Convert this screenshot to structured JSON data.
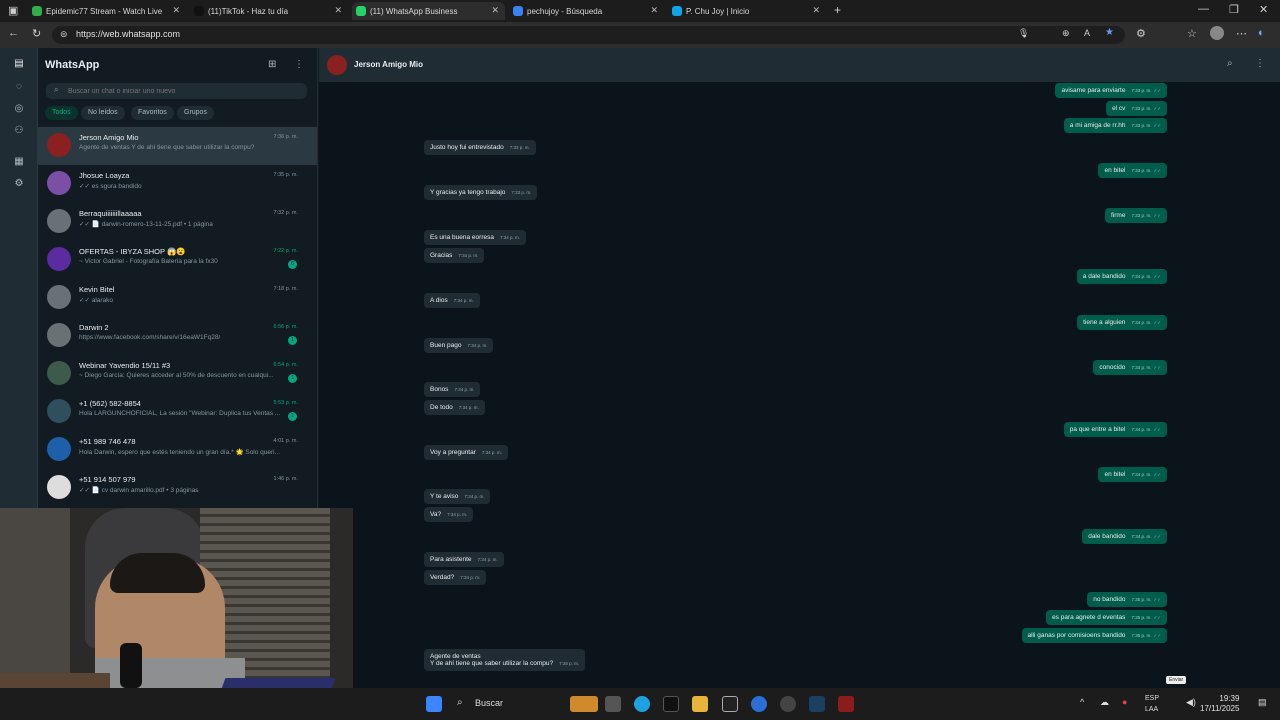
{
  "browser": {
    "tabs": [
      {
        "label": "Epidemic77 Stream - Watch Live",
        "color": "#2fae4a"
      },
      {
        "label": "(11)TikTok - Haz tu día",
        "color": "#111111"
      },
      {
        "label": "(11) WhatsApp Business",
        "color": "#25d366"
      },
      {
        "label": "pechujoy - Búsqueda",
        "color": "#3b82f6"
      },
      {
        "label": "P. Chu Joy | Inicio",
        "color": "#0ea5e9"
      }
    ],
    "new_tab": "+",
    "url": "https://web.whatsapp.com"
  },
  "sidebar": {
    "title": "WhatsApp",
    "search_placeholder": "Buscar un chat o iniciar uno nuevo",
    "filters": [
      "Todos",
      "No leídos",
      "Favoritos",
      "Grupos"
    ],
    "chats": [
      {
        "name": "Jerson Amigo Mio",
        "preview": "Agente de ventas Y de ahí tiene que saber utilizar la compu?",
        "time": "7:36 p. m.",
        "unread": false,
        "selected": true,
        "avatar": "#8b2020"
      },
      {
        "name": "Jhosue Loayza",
        "preview": "✓✓ es sgura bandido",
        "time": "7:35 p. m.",
        "unread": false,
        "avatar": "#7b4fa6"
      },
      {
        "name": "Berraquiiiiiiillaaaaa",
        "preview": "✓✓ 📄 darwin-romero-13-11-25.pdf • 1 página",
        "time": "7:32 p. m.",
        "unread": false,
        "avatar": "#6a7175"
      },
      {
        "name": "OFERTAS - IBYZA SHOP 😱😮",
        "preview": "~ Victor Gabriel - Fotografía Batería para la fx30",
        "time": "7:22 p. m.",
        "unread": true,
        "badge": "6",
        "avatar": "#5a2ca0"
      },
      {
        "name": "Kevin Bitel",
        "preview": "✓✓ alarako",
        "time": "7:18 p. m.",
        "unread": false,
        "avatar": "#6a7175"
      },
      {
        "name": "Darwin 2",
        "preview": "https://www.facebook.com/share/v/16eaW1Fq28/",
        "time": "6:56 p. m.",
        "unread": true,
        "badge": "1",
        "avatar": "#6a7175"
      },
      {
        "name": "Webinar Yavendio 15/11 #3",
        "preview": "~ Diego García: Quieres acceder al 50% de descuento en cualqui...",
        "time": "6:54 p. m.",
        "unread": true,
        "badge": "1",
        "avatar": "#3e5a4a"
      },
      {
        "name": "+1 (562) 582-8854",
        "preview": "Hola LARGUNCHOFICIAL, La sesión \"Webinar: Duplica tus Ventas ...",
        "time": "5:53 p. m.",
        "unread": true,
        "badge": "1",
        "avatar": "#2f4f5f"
      },
      {
        "name": "+51 989 746 478",
        "preview": "Hola Darwin, espero que estés teniendo un gran día.* 🌟 Solo queri...",
        "time": "4:01 p. m.",
        "unread": false,
        "avatar": "#1d5fa8"
      },
      {
        "name": "+51 914 507 979",
        "preview": "✓✓ 📄 cv darwin amarillo.pdf • 3 páginas",
        "time": "1:46 p. m.",
        "unread": false,
        "avatar": "#dddddd"
      }
    ]
  },
  "conversation": {
    "contact": "Jerson Amigo Mio",
    "messages": [
      {
        "dir": "out",
        "text": "avisame para enviarte",
        "time": "7:33 p. m."
      },
      {
        "dir": "out",
        "text": "el cv",
        "time": "7:33 p. m."
      },
      {
        "dir": "out",
        "text": "a mi amiga de rr.hh",
        "time": "7:33 p. m."
      },
      {
        "dir": "in",
        "text": "Justo hoy fui entrevistado",
        "time": "7:33 p. m."
      },
      {
        "dir": "out",
        "text": "en bitel",
        "time": "7:33 p. m."
      },
      {
        "dir": "in",
        "text": "Y gracias ya tengo trabajo",
        "time": "7:33 p. m."
      },
      {
        "dir": "out",
        "text": "firme",
        "time": "7:33 p. m."
      },
      {
        "dir": "in",
        "text": "Es una buena eorresa",
        "time": "7:34 p. m."
      },
      {
        "dir": "in",
        "text": "Gracias",
        "time": "7:34 p. m."
      },
      {
        "dir": "out",
        "text": "a dale bandido",
        "time": "7:34 p. m."
      },
      {
        "dir": "in",
        "text": "A dios",
        "time": "7:34 p. m."
      },
      {
        "dir": "out",
        "text": "tiene a alguien",
        "time": "7:34 p. m."
      },
      {
        "dir": "in",
        "text": "Buen pago",
        "time": "7:34 p. m."
      },
      {
        "dir": "out",
        "text": "conocido",
        "time": "7:34 p. m."
      },
      {
        "dir": "in",
        "text": "Bonos",
        "time": "7:34 p. m."
      },
      {
        "dir": "in",
        "text": "De todo",
        "time": "7:34 p. m."
      },
      {
        "dir": "out",
        "text": "pa que entre a bitel",
        "time": "7:34 p. m."
      },
      {
        "dir": "in",
        "text": "Voy a preguntar",
        "time": "7:34 p. m."
      },
      {
        "dir": "out",
        "text": "en bitel",
        "time": "7:34 p. m."
      },
      {
        "dir": "in",
        "text": "Y te aviso",
        "time": "7:34 p. m."
      },
      {
        "dir": "in",
        "text": "Va?",
        "time": "7:34 p. m."
      },
      {
        "dir": "out",
        "text": "dale bandido",
        "time": "7:34 p. m."
      },
      {
        "dir": "in",
        "text": "Para asistente",
        "time": "7:34 p. m."
      },
      {
        "dir": "in",
        "text": "Verdad?",
        "time": "7:34 p. m."
      },
      {
        "dir": "out",
        "text": "no bandido",
        "time": "7:35 p. m."
      },
      {
        "dir": "out",
        "text": "es para agnete d eventas",
        "time": "7:35 p. m."
      },
      {
        "dir": "out",
        "text": "alli ganas por comisioens bandido",
        "time": "7:35 p. m."
      },
      {
        "dir": "in",
        "text": "Agente de ventas",
        "text2": "Y de ahí tiene que saber utilizar la compu?",
        "time": "7:36 p. m."
      }
    ]
  },
  "taskbar": {
    "search_label": "Buscar",
    "lang": "ESP",
    "lang2": "LAA",
    "time": "19:39",
    "date": "17/11/2025",
    "tooltip": "Enviar"
  }
}
